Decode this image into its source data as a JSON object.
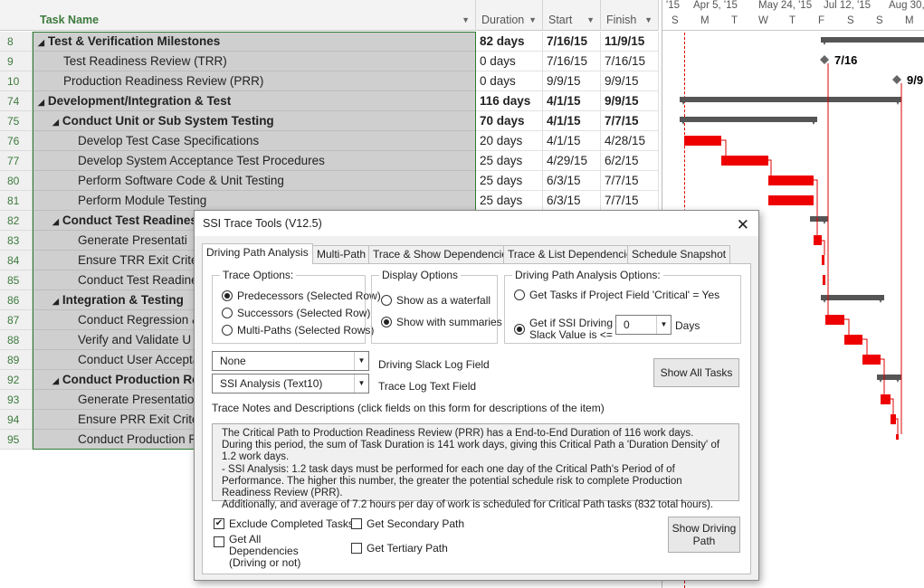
{
  "grid": {
    "headers": {
      "name": "Task Name",
      "duration": "Duration",
      "start": "Start",
      "finish": "Finish"
    },
    "rows": [
      {
        "id": "8",
        "name": "Test & Verification Milestones",
        "level": 0,
        "summary": true,
        "duration": "82 days",
        "start": "7/16/15",
        "finish": "11/9/15"
      },
      {
        "id": "9",
        "name": "Test Readiness Review (TRR)",
        "level": 1,
        "summary": false,
        "duration": "0 days",
        "start": "7/16/15",
        "finish": "7/16/15"
      },
      {
        "id": "10",
        "name": "Production Readiness Review (PRR)",
        "level": 1,
        "summary": false,
        "duration": "0 days",
        "start": "9/9/15",
        "finish": "9/9/15"
      },
      {
        "id": "74",
        "name": "Development/Integration & Test",
        "level": 0,
        "summary": true,
        "duration": "116 days",
        "start": "4/1/15",
        "finish": "9/9/15"
      },
      {
        "id": "75",
        "name": "Conduct Unit or Sub System Testing",
        "level": 1,
        "summary": true,
        "duration": "70 days",
        "start": "4/1/15",
        "finish": "7/7/15"
      },
      {
        "id": "76",
        "name": "Develop Test Case Specifications",
        "level": 2,
        "summary": false,
        "duration": "20 days",
        "start": "4/1/15",
        "finish": "4/28/15"
      },
      {
        "id": "77",
        "name": "Develop System Acceptance Test Procedures",
        "level": 2,
        "summary": false,
        "duration": "25 days",
        "start": "4/29/15",
        "finish": "6/2/15"
      },
      {
        "id": "80",
        "name": "Perform Software Code & Unit Testing",
        "level": 2,
        "summary": false,
        "duration": "25 days",
        "start": "6/3/15",
        "finish": "7/7/15"
      },
      {
        "id": "81",
        "name": "Perform Module Testing",
        "level": 2,
        "summary": false,
        "duration": "25 days",
        "start": "6/3/15",
        "finish": "7/7/15"
      },
      {
        "id": "82",
        "name": "Conduct Test Readiness",
        "level": 1,
        "summary": true,
        "duration": "",
        "start": "",
        "finish": ""
      },
      {
        "id": "83",
        "name": "Generate Presentati",
        "level": 2,
        "summary": false,
        "duration": "",
        "start": "",
        "finish": ""
      },
      {
        "id": "84",
        "name": "Ensure TRR Exit Criter",
        "level": 2,
        "summary": false,
        "duration": "",
        "start": "",
        "finish": ""
      },
      {
        "id": "85",
        "name": "Conduct Test Readine",
        "level": 2,
        "summary": false,
        "duration": "",
        "start": "",
        "finish": ""
      },
      {
        "id": "86",
        "name": "Integration & Testing",
        "level": 1,
        "summary": true,
        "duration": "",
        "start": "",
        "finish": ""
      },
      {
        "id": "87",
        "name": "Conduct Regression &",
        "level": 2,
        "summary": false,
        "duration": "",
        "start": "",
        "finish": ""
      },
      {
        "id": "88",
        "name": "Verify and Validate U",
        "level": 2,
        "summary": false,
        "duration": "",
        "start": "",
        "finish": ""
      },
      {
        "id": "89",
        "name": "Conduct User Accepta",
        "level": 2,
        "summary": false,
        "duration": "",
        "start": "",
        "finish": ""
      },
      {
        "id": "92",
        "name": "Conduct Production Rea",
        "level": 1,
        "summary": true,
        "duration": "",
        "start": "",
        "finish": ""
      },
      {
        "id": "93",
        "name": "Generate Presentatio",
        "level": 2,
        "summary": false,
        "duration": "",
        "start": "",
        "finish": ""
      },
      {
        "id": "94",
        "name": "Ensure PRR Exit Crite",
        "level": 2,
        "summary": false,
        "duration": "",
        "start": "",
        "finish": ""
      },
      {
        "id": "95",
        "name": "Conduct Production R",
        "level": 2,
        "summary": false,
        "duration": "",
        "start": "",
        "finish": ""
      }
    ]
  },
  "gantt": {
    "top": [
      "'15",
      "Apr 5, '15",
      "May 24, '15",
      "Jul 12, '15",
      "Aug 30,"
    ],
    "bottom": [
      "S",
      "M",
      "T",
      "W",
      "T",
      "F",
      "S",
      "S",
      "M"
    ],
    "milestone_labels": [
      "7/16",
      "9/9"
    ],
    "colors": {
      "critical": "#ee0000",
      "summary": "#555555",
      "status_line": "#dd0000"
    }
  },
  "dialog": {
    "title": "SSI Trace Tools (V12.5)",
    "close": "✕",
    "tabs": [
      "Driving Path Analysis",
      "Multi-Path",
      "Trace & Show Dependencies",
      "Trace & List Dependencies",
      "Schedule Snapshot"
    ],
    "trace_options": {
      "label": "Trace Options:",
      "items": [
        "Predecessors (Selected Row)",
        "Successors (Selected Row)",
        "Multi-Paths (Selected Rows)"
      ],
      "selected": 0
    },
    "display_options": {
      "label": "Display Options",
      "items": [
        "Show as a waterfall",
        "Show with summaries"
      ],
      "selected": 1
    },
    "dpa_options": {
      "label": "Driving Path Analysis Options:",
      "critical_label": "Get Tasks if Project Field 'Critical' = Yes",
      "slack_label": "Get if SSI Driving Slack Value is <=",
      "slack_value": "0",
      "days_label": "Days"
    },
    "slack_log_field": {
      "value": "None",
      "label": "Driving Slack Log Field"
    },
    "trace_log_field": {
      "value": "SSI Analysis (Text10)",
      "label": "Trace Log Text Field"
    },
    "show_all_tasks": "Show All Tasks",
    "notes_heading": "Trace Notes and Descriptions (click fields on this form for descriptions of the item)",
    "notes_lines": [
      "The Critical Path to Production Readiness Review (PRR) has a End-to-End Duration of 116 work days.",
      "During this period, the sum of Task Duration is 141 work days, giving this Critical Path a 'Duration Density' of 1.2 work days.",
      "- SSI Analysis: 1.2 task days must be performed for each one day of the Critical Path's Period of of Performance.  The higher this number, the greater the potential schedule risk to complete Production Readiness Review (PRR).",
      "Additionally, and average of 7.2 hours per day of work is scheduled for Critical Path tasks (832 total hours)."
    ],
    "exclude_completed": "Exclude Completed Tasks",
    "get_all_dependencies": "Get All Dependencies (Driving or not)",
    "secondary_path": "Get Secondary Path",
    "tertiary_path": "Get Tertiary Path",
    "show_driving_path": "Show Driving Path"
  }
}
